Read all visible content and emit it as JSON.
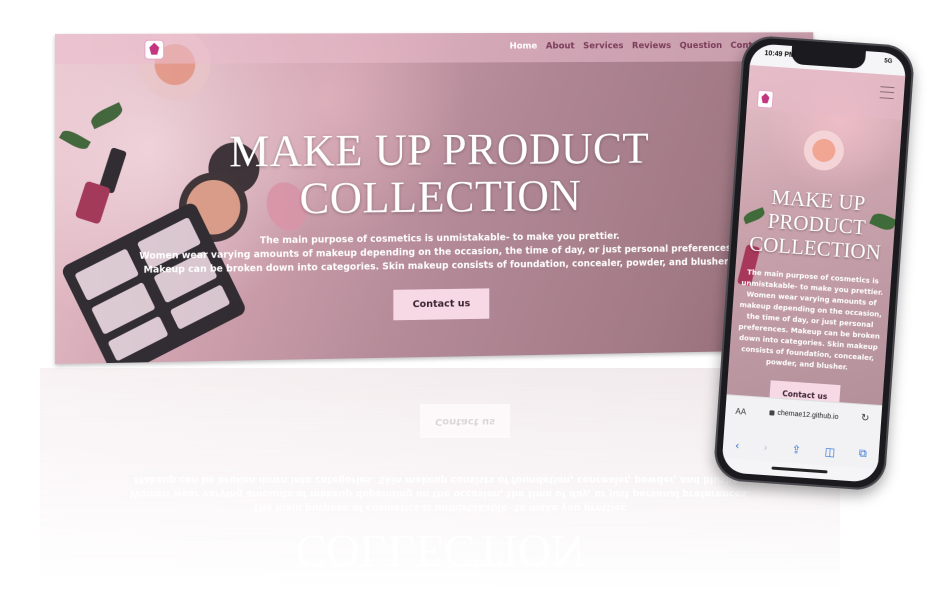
{
  "desktop": {
    "nav": {
      "links": [
        "Home",
        "About",
        "Services",
        "Reviews",
        "Question",
        "Contact"
      ],
      "active": "Home"
    },
    "hero": {
      "title_line1": "MAKE UP PRODUCT",
      "title_line2": "COLLECTION",
      "text_line1": "The main purpose of cosmetics is unmistakable- to make you prettier.",
      "text_line2": "Women wear varying amounts of makeup depending on the occasion, the time of day, or just personal preferences.",
      "text_line3": "Makeup can be broken down into categories. Skin makeup consists of foundation, concealer, powder, and blusher.",
      "button": "Contact us"
    }
  },
  "phone": {
    "time": "10:49 PM",
    "signal": "5G",
    "hero": {
      "title": "MAKE UP PRODUCT COLLECTION",
      "text": "The main purpose of cosmetics is unmistakable- to make you prettier. Women wear varying amounts of makeup depending on the occasion, the time of day, or just personal preferences. Makeup can be broken down into categories. Skin makeup consists of foundation, concealer, powder, and blusher.",
      "button": "Contact us"
    },
    "browser": {
      "aa": "AA",
      "url": "chemae12.github.io"
    }
  },
  "colors": {
    "accent_pink": "#f7d9e6",
    "nav_text": "#7a3d58",
    "safari_blue": "#2d6fd6"
  },
  "icons": [
    "logo-icon",
    "hamburger-icon",
    "lock-icon",
    "reload-icon",
    "back-icon",
    "forward-icon",
    "share-icon",
    "bookmarks-icon",
    "tabs-icon"
  ]
}
